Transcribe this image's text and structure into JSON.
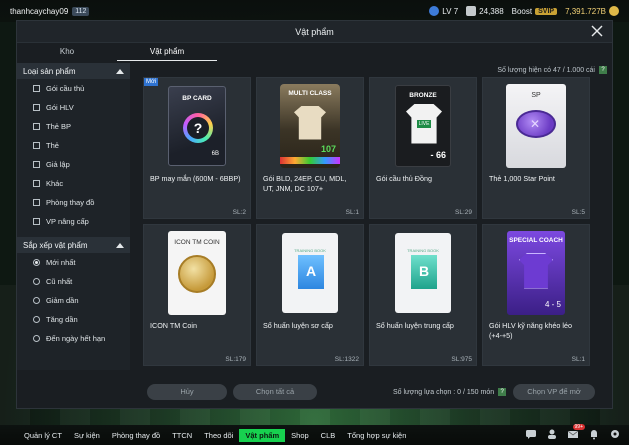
{
  "topbar": {
    "username": "thanhcaychay09",
    "user_level": "112",
    "lv": "LV 7",
    "points": "24,388",
    "boost_label": "Boost",
    "svip": "SVIP",
    "coins": "7,391.727B"
  },
  "modal": {
    "title": "Vật phẩm",
    "tabs": [
      {
        "label": "Kho"
      },
      {
        "label": "Vật phẩm"
      }
    ],
    "count_label": "Số lượng hiện có  47 / 1.000 cái"
  },
  "sidebar": {
    "type_section": "Loại sản phẩm",
    "type_options": [
      {
        "label": "Gói cầu thủ"
      },
      {
        "label": "Gói HLV"
      },
      {
        "label": "Thẻ BP"
      },
      {
        "label": "Thẻ"
      },
      {
        "label": "Giả lập"
      },
      {
        "label": "Khác"
      },
      {
        "label": "Phòng thay đồ"
      },
      {
        "label": "VP nâng cấp"
      }
    ],
    "sort_section": "Sắp xếp vật phẩm",
    "sort_options": [
      {
        "label": "Mới nhất",
        "selected": true
      },
      {
        "label": "Cũ nhất",
        "selected": false
      },
      {
        "label": "Giảm dần",
        "selected": false
      },
      {
        "label": "Tăng dần",
        "selected": false
      },
      {
        "label": "Đến ngày hết hạn",
        "selected": false
      }
    ]
  },
  "items": [
    {
      "name": "BP may mắn (600M - 6BBP)",
      "qty": "SL:2",
      "new": "Mới",
      "art": "bp",
      "art_title": "BP CARD",
      "art_sub": "6B"
    },
    {
      "name": "Gói BLD, 24EP, CU, MDL, UT, JNM, DC 107+",
      "qty": "SL:1",
      "art": "mc",
      "art_title": "MULTI CLASS",
      "art_sub": "107"
    },
    {
      "name": "Gói cầu thủ Đồng",
      "qty": "SL:29",
      "art": "bronze",
      "art_title": "BRONZE",
      "art_sub": "- 66"
    },
    {
      "name": "Thẻ 1,000 Star Point",
      "qty": "SL:5",
      "art": "sp",
      "art_title": "SP",
      "art_sub": ""
    },
    {
      "name": "ICON TM Coin",
      "qty": "SL:179",
      "art": "icon",
      "art_title": "ICON TM COIN",
      "art_sub": ""
    },
    {
      "name": "Sổ huấn luyện sơ cấp",
      "qty": "SL:1322",
      "art": "bookA",
      "art_title": "A",
      "art_sub": ""
    },
    {
      "name": "Sổ huấn luyện trung cấp",
      "qty": "SL:975",
      "art": "bookB",
      "art_title": "B",
      "art_sub": ""
    },
    {
      "name": "Gói HLV kỹ năng khéo léo (+4-+5)",
      "qty": "SL:1",
      "art": "coach",
      "art_title": "SPECIAL COACH",
      "art_sub": "4 - 5"
    }
  ],
  "footer": {
    "cancel": "Hủy",
    "select_all": "Chọn tất cả",
    "selected_count": "Số lượng lựa chọn : 0 / 150 món",
    "select_vp": "Chọn VP để mở"
  },
  "bottomnav": {
    "items": [
      "Quản lý CT",
      "Sự kiện",
      "Phòng thay đồ",
      "TTCN",
      "Theo dõi",
      "Vật phẩm",
      "Shop",
      "CLB",
      "Tổng hợp sự kiện"
    ],
    "active_index": 5,
    "mail_badge": "99+"
  },
  "colors": {
    "accent_green": "#17d14f",
    "new_badge_blue": "#2f73d1"
  }
}
